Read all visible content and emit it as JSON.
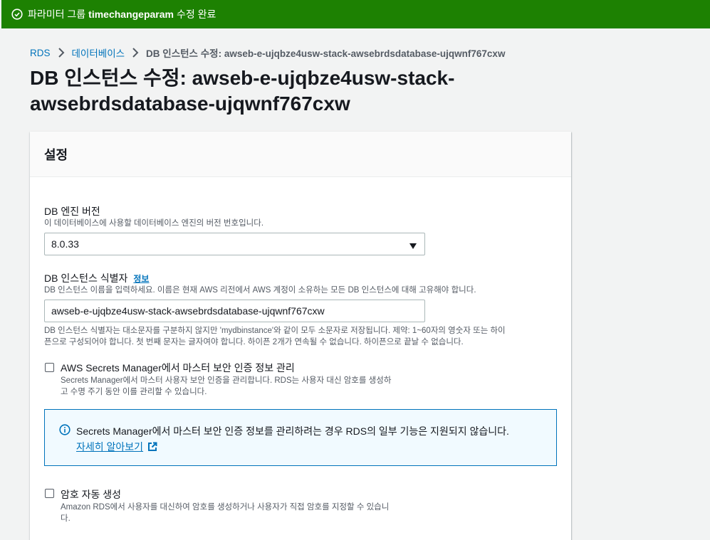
{
  "flash": {
    "prefix": "파라미터 그룹",
    "param_name": "timechangeparam",
    "suffix": "수정 완료"
  },
  "breadcrumb": {
    "rds": "RDS",
    "databases": "데이터베이스",
    "current": "DB 인스턴스 수정: awseb-e-ujqbze4usw-stack-awsebrdsdatabase-ujqwnf767cxw"
  },
  "page_title": "DB 인스턴스 수정: awseb-e-ujqbze4usw-stack-awsebrdsdatabase-ujqwnf767cxw",
  "panel": {
    "title": "설정",
    "engine_version": {
      "label": "DB 엔진 버전",
      "description": "이 데이터베이스에 사용할 데이터베이스 엔진의 버전 번호입니다.",
      "selected": "8.0.33"
    },
    "identifier": {
      "label": "DB 인스턴스 식별자",
      "info": "정보",
      "description": "DB 인스턴스 이름을 입력하세요. 이름은 현재 AWS 리전에서 AWS 계정이 소유하는 모든 DB 인스턴스에 대해 고유해야 합니다.",
      "value": "awseb-e-ujqbze4usw-stack-awsebrdsdatabase-ujqwnf767cxw",
      "constraint_line1": "DB 인스턴스 식별자는 대소문자를 구분하지 않지만 'mydbinstance'와 같이 모두 소문자로 저장됩니다. 제약: 1~60자의 영숫자 또는 하이",
      "constraint_line2": "픈으로 구성되어야 합니다. 첫 번째 문자는 글자여야 합니다. 하이픈 2개가 연속될 수 없습니다. 하이픈으로 끝날 수 없습니다."
    },
    "secrets_manager": {
      "label": "AWS Secrets Manager에서 마스터 보안 인증 정보 관리",
      "desc_line1": "Secrets Manager에서 마스터 사용자 보안 인증을 관리합니다. RDS는 사용자 대신 암호를 생성하",
      "desc_line2": "고 수명 주기 동안 이를 관리할 수 있습니다.",
      "checked": false
    },
    "alert": {
      "message": "Secrets Manager에서 마스터 보안 인증 정보를 관리하려는 경우 RDS의 일부 기능은 지원되지 않습니다.",
      "link": "자세히 알아보기"
    },
    "auto_password": {
      "label": "암호 자동 생성",
      "desc_line1": "Amazon RDS에서 사용자를 대신하여 암호를 생성하거나 사용자가 직접 암호를 지정할 수 있습니",
      "desc_line2": "다.",
      "checked": false
    }
  },
  "colors": {
    "flash_bg": "#1d8102",
    "link": "#0073bb",
    "alert_bg": "#f1faff"
  }
}
